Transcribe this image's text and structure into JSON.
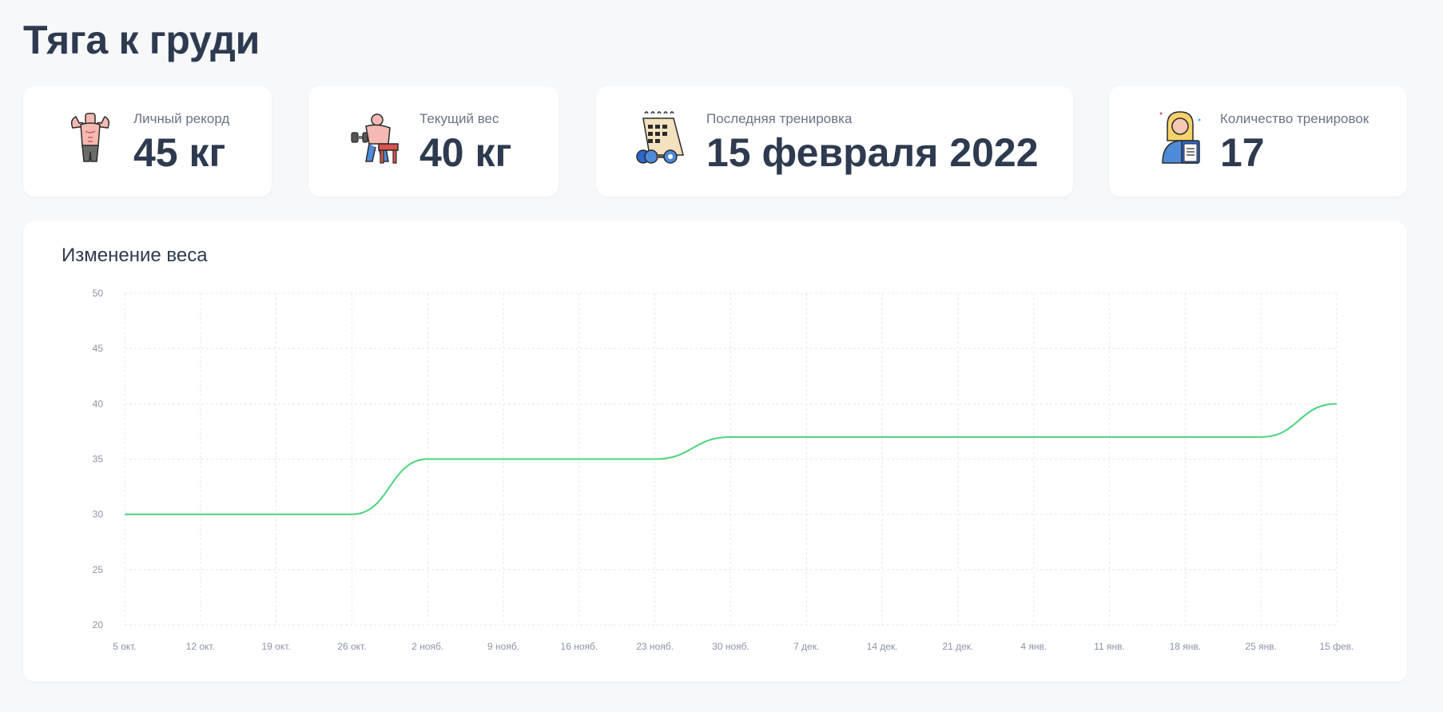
{
  "page": {
    "title": "Тяга к груди"
  },
  "stats": [
    {
      "label": "Личный рекорд",
      "value": "45 кг",
      "icon": "bodybuilder-icon"
    },
    {
      "label": "Текущий вес",
      "value": "40 кг",
      "icon": "dumbbell-workout-icon"
    },
    {
      "label": "Последняя тренировка",
      "value": "15 февраля 2022",
      "icon": "calendar-weights-icon"
    },
    {
      "label": "Количество тренировок",
      "value": "17",
      "icon": "trainer-clipboard-icon"
    }
  ],
  "chart": {
    "title": "Изменение веса"
  },
  "chart_data": {
    "type": "line",
    "title": "Изменение веса",
    "xlabel": "",
    "ylabel": "",
    "categories": [
      "5 окт.",
      "12 окт.",
      "19 окт.",
      "26 окт.",
      "2 нояб.",
      "9 нояб.",
      "16 нояб.",
      "23 нояб.",
      "30 нояб.",
      "7 дек.",
      "14 дек.",
      "21 дек.",
      "4 янв.",
      "11 янв.",
      "18 янв.",
      "25 янв.",
      "15 фев."
    ],
    "series": [
      {
        "values": [
          30,
          30,
          30,
          30,
          35,
          35,
          35,
          35,
          37,
          37,
          37,
          37,
          37,
          37,
          37,
          37,
          40
        ]
      }
    ],
    "ylim": [
      20,
      50
    ],
    "yticks": [
      20,
      25,
      30,
      35,
      40,
      45,
      50
    ],
    "grid": true,
    "grid_style": "dashed",
    "line_color": "#4cd47a",
    "grid_color": "#e6e8ee"
  }
}
